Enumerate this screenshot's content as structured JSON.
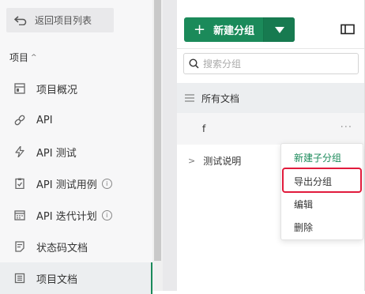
{
  "sidebar": {
    "back_label": "返回项目列表",
    "section_title": "项目",
    "section_caret": "^",
    "items": [
      {
        "label": "项目概况",
        "icon": "overview-icon"
      },
      {
        "label": "API",
        "icon": "link-icon"
      },
      {
        "label": "API 测试",
        "icon": "lightning-icon"
      },
      {
        "label": "API 测试用例",
        "icon": "clipboard-check-icon",
        "info": "i"
      },
      {
        "label": "API 迭代计划",
        "icon": "calendar-icon",
        "info": "i"
      },
      {
        "label": "状态码文档",
        "icon": "document-icon"
      },
      {
        "label": "项目文档",
        "icon": "book-icon",
        "active": true
      }
    ]
  },
  "panel": {
    "new_group_plus": "+",
    "new_group_label": "新建分组",
    "search_placeholder": "搜索分组",
    "all_docs_label": "所有文档",
    "groups": [
      {
        "label": "f",
        "more": "···"
      },
      {
        "label": "测试说明",
        "arrow": ">"
      }
    ]
  },
  "context_menu": {
    "items": [
      "新建子分组",
      "导出分组",
      "编辑",
      "删除"
    ],
    "highlighted_item": "导出分组"
  },
  "colors": {
    "accent": "#1b8a5a",
    "highlight_border": "#e11b3c"
  }
}
